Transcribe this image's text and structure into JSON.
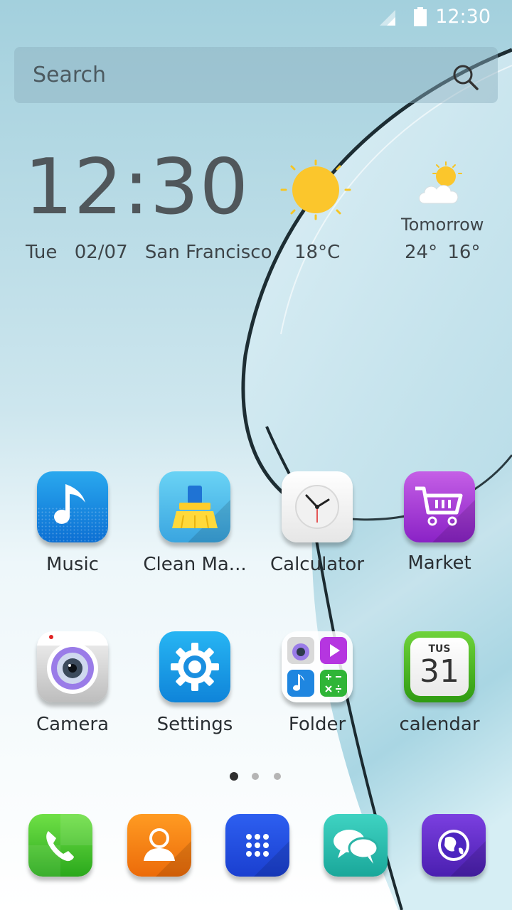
{
  "status_bar": {
    "time": "12:30",
    "signal_icon": "signal-icon",
    "battery_icon": "battery-icon"
  },
  "search": {
    "placeholder": "Search",
    "icon": "search-icon"
  },
  "clock_widget": {
    "time": "12:30",
    "day": "Tue",
    "date": "02/07",
    "city": "San Francisco",
    "current_temp": "18°C",
    "current_icon": "sun-icon",
    "tomorrow_label": "Tomorrow",
    "tomorrow_high": "24°",
    "tomorrow_low": "16°",
    "tomorrow_icon": "partly-cloudy-icon"
  },
  "apps": [
    {
      "label": "Music",
      "icon": "music-note-icon"
    },
    {
      "label": "Clean Ma...",
      "icon": "broom-icon"
    },
    {
      "label": "Calculator",
      "icon": "clock-icon"
    },
    {
      "label": "Market",
      "icon": "shopping-cart-icon"
    },
    {
      "label": "Camera",
      "icon": "camera-icon"
    },
    {
      "label": "Settings",
      "icon": "gear-icon"
    },
    {
      "label": "Folder",
      "icon": "folder-icon"
    },
    {
      "label": "calendar",
      "icon": "calendar-icon",
      "calendar_day": "TUS",
      "calendar_date": "31"
    }
  ],
  "pager": {
    "pages": 3,
    "current": 1
  },
  "dock": [
    {
      "name": "phone",
      "icon": "phone-icon"
    },
    {
      "name": "contacts",
      "icon": "contacts-icon"
    },
    {
      "name": "app-drawer",
      "icon": "app-grid-icon"
    },
    {
      "name": "messages",
      "icon": "chat-bubbles-icon"
    },
    {
      "name": "browser",
      "icon": "globe-icon"
    }
  ]
}
